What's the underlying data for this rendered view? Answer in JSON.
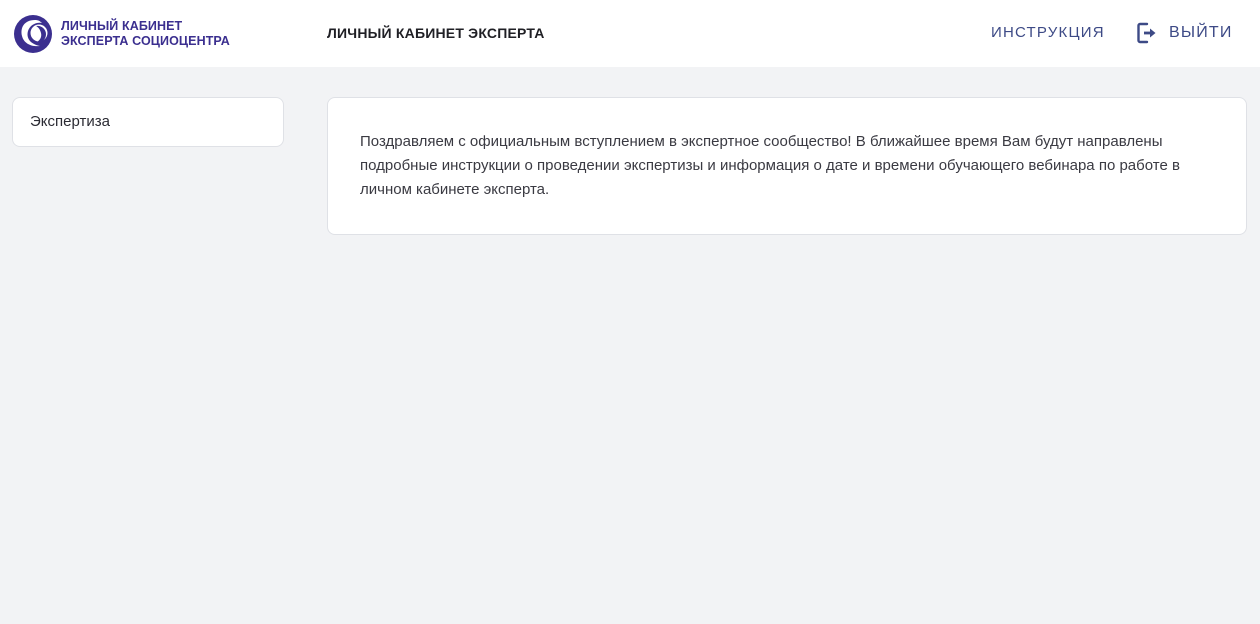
{
  "header": {
    "logo_line1": "ЛИЧНЫЙ КАБИНЕТ",
    "logo_line2": "ЭКСПЕРТА СОЦИОЦЕНТРА",
    "title": "ЛИЧНЫЙ КАБИНЕТ ЭКСПЕРТА",
    "instruction_label": "ИНСТРУКЦИЯ",
    "logout_label": "ВЫЙТИ",
    "logout_icon": "logout-icon"
  },
  "sidebar": {
    "items": [
      {
        "label": "Экспертиза"
      }
    ]
  },
  "main": {
    "message": "Поздравляем с официальным вступлением в экспертное сообщество! В ближайшее время Вам будут направлены подробные инструкции о проведении экспертизы и информация о дате и времени обучающего вебинара по работе в личном кабинете эксперта."
  },
  "colors": {
    "brand": "#3b2f8f",
    "nav_text": "#3d4a86",
    "background": "#f2f3f5",
    "card": "#ffffff"
  }
}
